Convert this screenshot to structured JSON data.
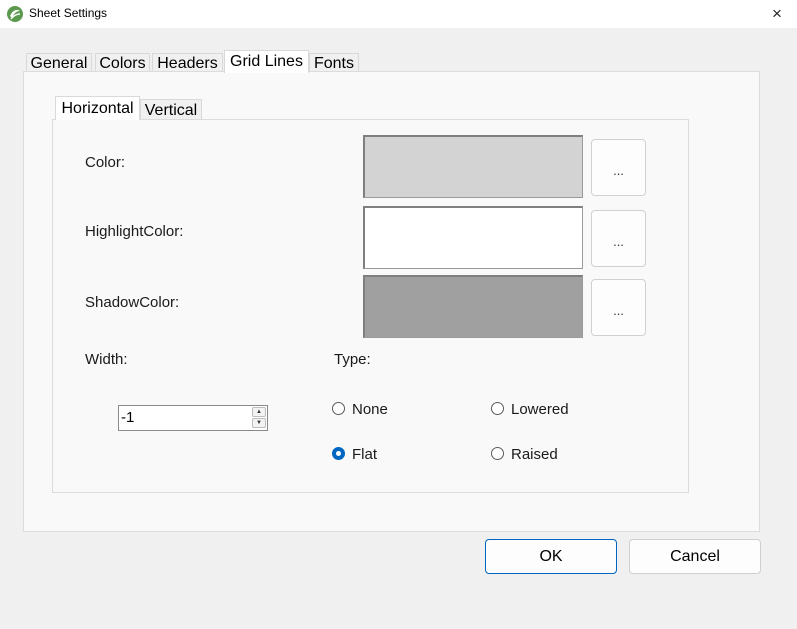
{
  "window": {
    "title": "Sheet Settings",
    "icon": "sheet-app-icon",
    "close_icon": "×"
  },
  "tabs": [
    {
      "label": "General",
      "active": false
    },
    {
      "label": "Colors",
      "active": false
    },
    {
      "label": "Headers",
      "active": false
    },
    {
      "label": "Grid Lines",
      "active": true
    },
    {
      "label": "Fonts",
      "active": false
    }
  ],
  "subtabs": [
    {
      "label": "Horizontal",
      "active": true
    },
    {
      "label": "Vertical",
      "active": false
    }
  ],
  "colors": {
    "color": {
      "label": "Color:",
      "value": "#d3d3d3",
      "button": "..."
    },
    "highlight": {
      "label": "HighlightColor:",
      "value": "#ffffff",
      "button": "..."
    },
    "shadow": {
      "label": "ShadowColor:",
      "value": "#a0a0a0",
      "button": "..."
    }
  },
  "width": {
    "label": "Width:",
    "value": "-1"
  },
  "type": {
    "label": "Type:",
    "options": [
      {
        "label": "None",
        "checked": false
      },
      {
        "label": "Lowered",
        "checked": false
      },
      {
        "label": "Flat",
        "checked": true
      },
      {
        "label": "Raised",
        "checked": false
      }
    ]
  },
  "buttons": {
    "ok": "OK",
    "cancel": "Cancel"
  },
  "accent_color": "#0067c0"
}
